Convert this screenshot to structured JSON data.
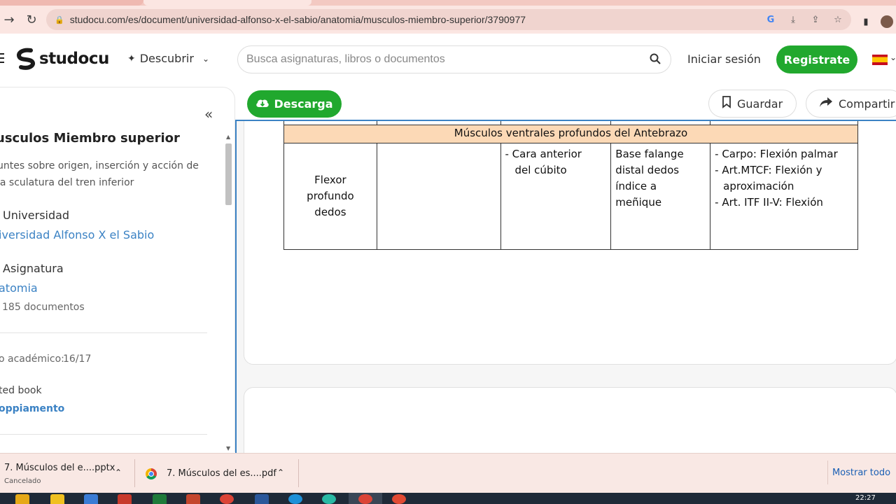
{
  "browser": {
    "url": "studocu.com/es/document/universidad-alfonso-x-el-sabio/anatomia/musculos-miembro-superior/3790977"
  },
  "header": {
    "logo_text": "studocu",
    "discover_label": "Descubrir",
    "search_placeholder": "Busca asignaturas, libros o documentos",
    "login_label": "Iniciar sesión",
    "register_label": "Registrate"
  },
  "sidebar": {
    "doc_title": "usculos Miembro superior",
    "doc_desc": "untes sobre origen, inserción y acción de la sculatura del tren inferior",
    "university_label": "Universidad",
    "university_value": "iversidad Alfonso X el Sabio",
    "subject_label": "Asignatura",
    "subject_value": "atomia",
    "subject_docs": "185 documentos",
    "year_label": "o académico:",
    "year_value": "16/17",
    "book_label": "ted book",
    "book_value": "oppiamento"
  },
  "actions": {
    "download_label": "Descarga",
    "save_label": "Guardar",
    "share_label": "Compartir"
  },
  "document": {
    "section_header": "Músculos ventrales profundos del Antebrazo",
    "muscle": {
      "name_line1": "Flexor",
      "name_line2": "profundo",
      "name_line3": "dedos",
      "origin_line1": "- Cara anterior",
      "origin_line2": "del cúbito",
      "insertion_line1": "Base falange",
      "insertion_line2": "distal dedos",
      "insertion_line3": "índice a",
      "insertion_line4": "meñique",
      "action_line1": "- Carpo: Flexión palmar",
      "action_line2": "- Art.MTCF: Flexión y",
      "action_line3": "aproximación",
      "action_line4": "- Art. ITF II-V: Flexión"
    }
  },
  "downloads": {
    "item1_name": "7. Músculos del e....pptx",
    "item1_status": "Cancelado",
    "item2_name": "7. Músculos del es....pdf",
    "show_all": "Mostrar todo"
  },
  "taskbar": {
    "time": "22:27"
  },
  "colors": {
    "brand_green": "#21a82e",
    "link_blue": "#3b82c4",
    "table_header_bg": "#fcd9b6",
    "chrome_pink": "#fbe6e2"
  }
}
